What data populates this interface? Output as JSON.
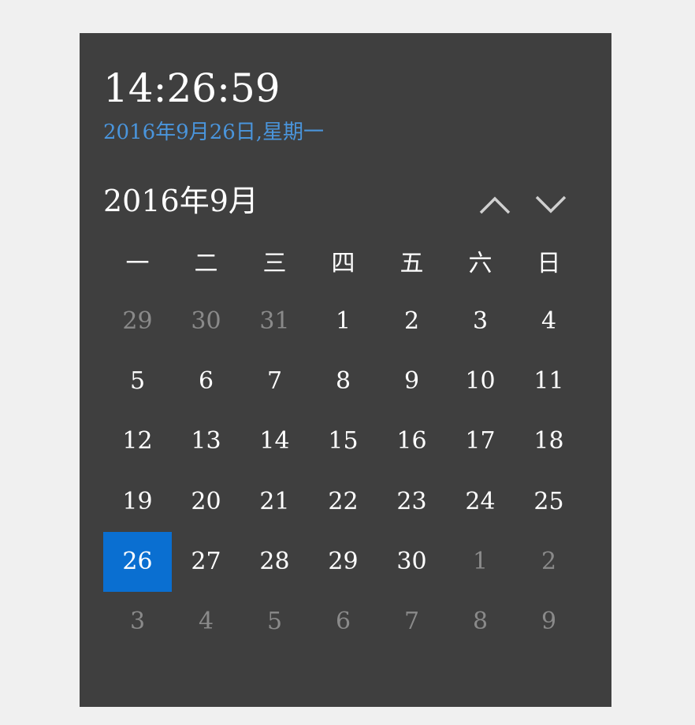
{
  "clock": {
    "time": "14:26:59",
    "date_line": "2016年9月26日,星期一"
  },
  "calendar": {
    "month_title": "2016年9月",
    "prev_icon": "chevron-up-icon",
    "next_icon": "chevron-down-icon",
    "weekdays": [
      "一",
      "二",
      "三",
      "四",
      "五",
      "六",
      "日"
    ],
    "weeks": [
      [
        {
          "d": "29",
          "o": true
        },
        {
          "d": "30",
          "o": true
        },
        {
          "d": "31",
          "o": true
        },
        {
          "d": "1"
        },
        {
          "d": "2"
        },
        {
          "d": "3"
        },
        {
          "d": "4"
        }
      ],
      [
        {
          "d": "5"
        },
        {
          "d": "6"
        },
        {
          "d": "7"
        },
        {
          "d": "8"
        },
        {
          "d": "9"
        },
        {
          "d": "10"
        },
        {
          "d": "11"
        }
      ],
      [
        {
          "d": "12"
        },
        {
          "d": "13"
        },
        {
          "d": "14"
        },
        {
          "d": "15"
        },
        {
          "d": "16"
        },
        {
          "d": "17"
        },
        {
          "d": "18"
        }
      ],
      [
        {
          "d": "19"
        },
        {
          "d": "20"
        },
        {
          "d": "21"
        },
        {
          "d": "22"
        },
        {
          "d": "23"
        },
        {
          "d": "24"
        },
        {
          "d": "25"
        }
      ],
      [
        {
          "d": "26",
          "s": true
        },
        {
          "d": "27"
        },
        {
          "d": "28"
        },
        {
          "d": "29"
        },
        {
          "d": "30"
        },
        {
          "d": "1",
          "o": true
        },
        {
          "d": "2",
          "o": true
        }
      ],
      [
        {
          "d": "3",
          "o": true
        },
        {
          "d": "4",
          "o": true
        },
        {
          "d": "5",
          "o": true
        },
        {
          "d": "6",
          "o": true
        },
        {
          "d": "7",
          "o": true
        },
        {
          "d": "8",
          "o": true
        },
        {
          "d": "9",
          "o": true
        }
      ]
    ],
    "selected_color": "#0a6fd1",
    "link_color": "#4a95dc"
  }
}
